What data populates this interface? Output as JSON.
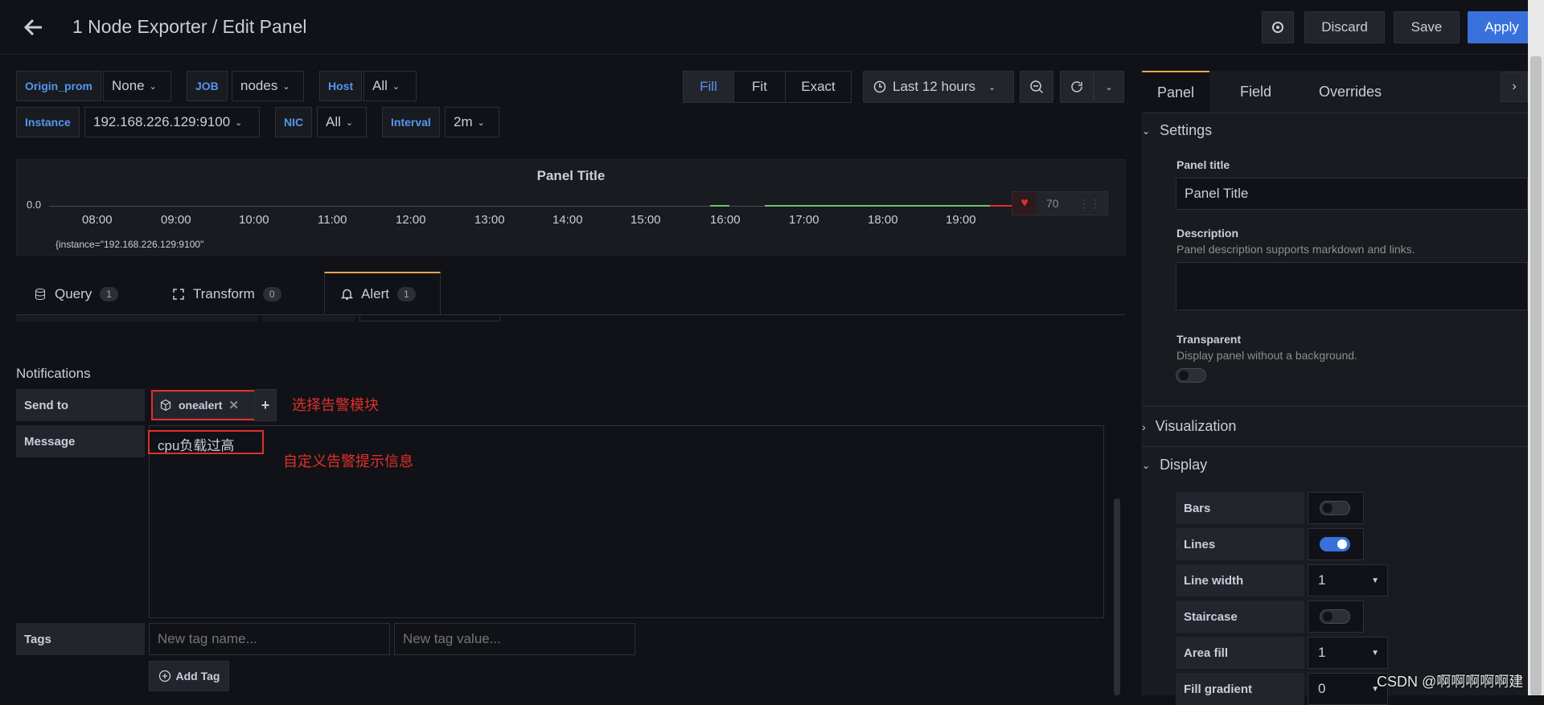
{
  "header": {
    "title": "1 Node Exporter / Edit Panel",
    "discard": "Discard",
    "save": "Save",
    "apply": "Apply"
  },
  "variables": {
    "origin_prom": {
      "label": "Origin_prom",
      "value": "None"
    },
    "job": {
      "label": "JOB",
      "value": "nodes"
    },
    "host": {
      "label": "Host",
      "value": "All"
    },
    "instance": {
      "label": "Instance",
      "value": "192.168.226.129:9100"
    },
    "nic": {
      "label": "NIC",
      "value": "All"
    },
    "interval": {
      "label": "Interval",
      "value": "2m"
    }
  },
  "view_modes": {
    "fill": "Fill",
    "fit": "Fit",
    "exact": "Exact"
  },
  "time_picker": {
    "range": "Last 12 hours"
  },
  "panel": {
    "title": "Panel Title",
    "y_label": "0.0",
    "legend": "{instance=\"192.168.226.129:9100\"",
    "threshold_value": "70",
    "x_ticks": [
      "08:00",
      "09:00",
      "10:00",
      "11:00",
      "12:00",
      "13:00",
      "14:00",
      "15:00",
      "16:00",
      "17:00",
      "18:00",
      "19:00"
    ]
  },
  "tabs": {
    "query": {
      "label": "Query",
      "count": "1"
    },
    "transform": {
      "label": "Transform",
      "count": "0"
    },
    "alert": {
      "label": "Alert",
      "count": "1"
    }
  },
  "notifications": {
    "heading": "Notifications",
    "send_to_label": "Send to",
    "channel": "onealert",
    "message_label": "Message",
    "message_value": "cpu负载过高",
    "tags_label": "Tags",
    "tag_name_placeholder": "New tag name...",
    "tag_value_placeholder": "New tag value...",
    "add_tag": "Add Tag"
  },
  "annotations": {
    "send_to_note": "选择告警模块",
    "message_note": "自定义告警提示信息"
  },
  "options": {
    "tabs": {
      "panel": "Panel",
      "field": "Field",
      "overrides": "Overrides"
    },
    "settings": {
      "heading": "Settings",
      "panel_title_label": "Panel title",
      "panel_title_value": "Panel Title",
      "description_label": "Description",
      "description_hint": "Panel description supports markdown and links.",
      "transparent_label": "Transparent",
      "transparent_hint": "Display panel without a background."
    },
    "visualization": "Visualization",
    "display": {
      "heading": "Display",
      "bars": "Bars",
      "lines": "Lines",
      "line_width": "Line width",
      "line_width_value": "1",
      "staircase": "Staircase",
      "area_fill": "Area fill",
      "area_fill_value": "1",
      "fill_gradient": "Fill gradient",
      "fill_gradient_value": "0"
    }
  },
  "watermark": "CSDN @啊啊啊啊啊建"
}
